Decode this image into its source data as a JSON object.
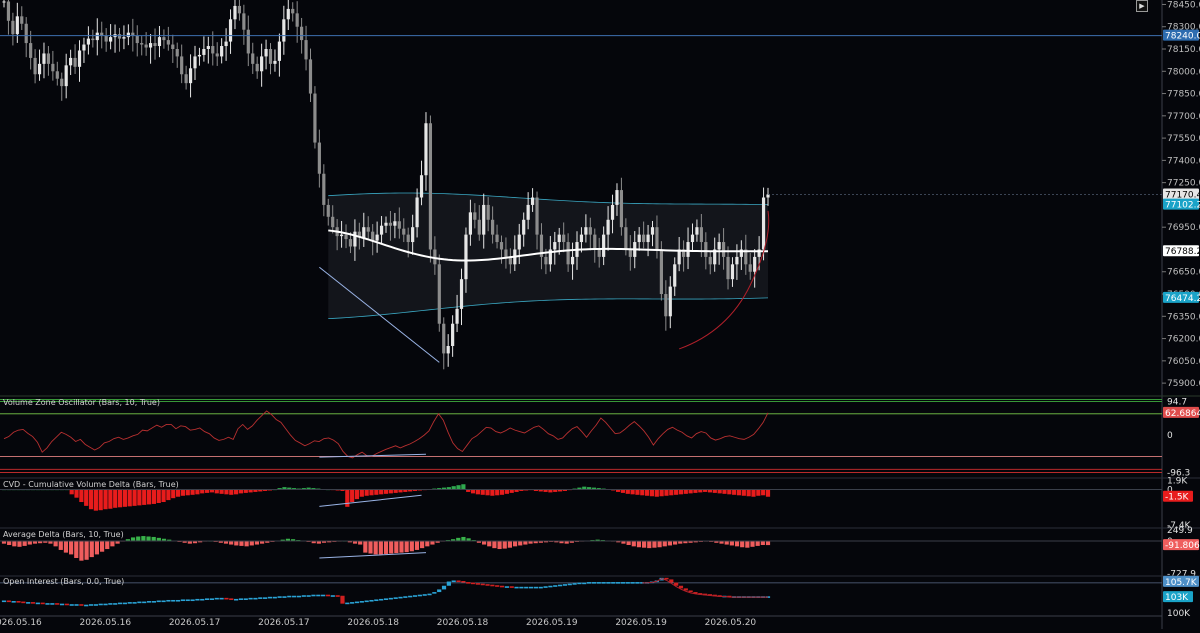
{
  "chart_data": [
    {
      "type": "candlestick",
      "title": "",
      "xlabel": "",
      "ylabel": "",
      "x_tick_labels": [
        "2026.05.16",
        "2026.05.16",
        "2026.05.17",
        "2026.05.17",
        "2026.05.18",
        "2026.05.18",
        "2026.05.19",
        "2026.05.19",
        "2026.05.20"
      ],
      "y_tick_labels": [
        "78450.0",
        "78300.0",
        "78150.0",
        "78000.0",
        "77850.0",
        "77700.0",
        "77550.0",
        "77400.0",
        "77250.0",
        "76950.0",
        "76650.0",
        "76500.0",
        "76350.0",
        "76200.0",
        "76050.0",
        "75900.0"
      ],
      "ylim": [
        75820,
        78480
      ],
      "horizontal_line": 78240.0,
      "last_price": 77170.4,
      "price_tags": [
        "78240.0",
        "77170.4",
        "77102.2",
        "76788.2",
        "76474.2"
      ],
      "vwap_band": {
        "upper": 77102.2,
        "mid": 76788.2,
        "lower": 76474.2
      },
      "closes": [
        78470,
        78340,
        78250,
        78370,
        78320,
        78190,
        78090,
        77980,
        78050,
        78120,
        78050,
        78000,
        77950,
        77900,
        78040,
        78090,
        78030,
        78140,
        78180,
        78220,
        78210,
        78260,
        78240,
        78200,
        78230,
        78250,
        78220,
        78230,
        78260,
        78240,
        78190,
        78180,
        78160,
        78190,
        78170,
        78230,
        78210,
        78180,
        78150,
        78100,
        77980,
        77920,
        78020,
        78100,
        78110,
        78150,
        78170,
        78120,
        78100,
        78170,
        78200,
        78350,
        78440,
        78390,
        78280,
        78120,
        78050,
        78000,
        78100,
        78150,
        78050,
        78070,
        78200,
        78350,
        78420,
        78390,
        78300,
        78210,
        78080,
        77850,
        77520,
        77310,
        77100,
        77020,
        76950,
        76890,
        76900,
        76870,
        76820,
        76920,
        76880,
        76950,
        76920,
        76860,
        76900,
        76960,
        76980,
        76960,
        76990,
        76940,
        76900,
        76850,
        76950,
        77150,
        77300,
        77650,
        76800,
        76700,
        76300,
        76100,
        76150,
        76300,
        76400,
        76600,
        76900,
        77050,
        77000,
        76900,
        77100,
        77000,
        76900,
        76850,
        76800,
        76750,
        76700,
        76800,
        76900,
        77000,
        77100,
        77150,
        76900,
        76750,
        76700,
        76800,
        76850,
        76900,
        76850,
        76700,
        76750,
        76850,
        76900,
        76950,
        76900,
        76800,
        76750,
        76900,
        77000,
        77100,
        77200,
        76950,
        76800,
        76750,
        76850,
        76900,
        76850,
        76900,
        76950,
        76800,
        76500,
        76350,
        76550,
        76700,
        76800,
        76750,
        76850,
        76900,
        76950,
        76850,
        76750,
        76700,
        76800,
        76850,
        76750,
        76600,
        76700,
        76750,
        76800,
        76700,
        76650,
        76750,
        76800,
        77150,
        77170.4
      ]
    },
    {
      "type": "line",
      "title": "Volume Zone Oscillator (Bars, 10, True)",
      "levels": [
        94.7,
        62.6864,
        0,
        -96.3
      ],
      "last_value": 62.6864,
      "series": [
        {
          "values": [
            -10,
            -4,
            8,
            14,
            16,
            5,
            -4,
            -20,
            -48,
            -36,
            -18,
            -5,
            8,
            2,
            -6,
            -18,
            -12,
            -26,
            -34,
            -42,
            -35,
            -22,
            -18,
            -10,
            -6,
            -12,
            -8,
            -2,
            2,
            14,
            12,
            20,
            28,
            22,
            30,
            30,
            18,
            26,
            24,
            14,
            16,
            20,
            10,
            4,
            -8,
            -15,
            -12,
            -6,
            -12,
            18,
            30,
            16,
            26,
            42,
            55,
            68,
            58,
            44,
            36,
            18,
            0,
            -15,
            -22,
            -30,
            -24,
            -16,
            -18,
            -10,
            -8,
            -14,
            -24,
            -46,
            -60,
            -64,
            -55,
            -48,
            -58,
            -60,
            -52,
            -46,
            -40,
            -35,
            -30,
            -36,
            -30,
            -25,
            -18,
            -10,
            0,
            12,
            38,
            60,
            42,
            8,
            -22,
            -38,
            -46,
            -28,
            -10,
            -2,
            10,
            22,
            20,
            10,
            6,
            12,
            20,
            14,
            10,
            6,
            14,
            22,
            26,
            16,
            4,
            -2,
            -12,
            -8,
            6,
            18,
            24,
            10,
            -6,
            12,
            28,
            48,
            36,
            20,
            4,
            6,
            16,
            28,
            38,
            26,
            12,
            -6,
            -28,
            -10,
            4,
            16,
            22,
            14,
            8,
            -2,
            -8,
            4,
            10,
            6,
            -8,
            -14,
            -10,
            -4,
            -2,
            -6,
            -10,
            -12,
            -6,
            2,
            18,
            36,
            62.6864
          ]
        }
      ]
    },
    {
      "type": "bar",
      "title": "CVD - Cumulative Volume Delta (Bars, True)",
      "levels": [
        1900,
        0,
        -7400
      ],
      "y_tick_labels": [
        "1.9K",
        "0",
        "-7.4K"
      ],
      "last_value_label": "-1.5K",
      "values": [
        0,
        0,
        0,
        0,
        0,
        0,
        0,
        0,
        0,
        0,
        0,
        0,
        0,
        0,
        -1000,
        -1700,
        -2600,
        -3400,
        -4100,
        -4400,
        -4300,
        -4100,
        -4000,
        -3800,
        -3700,
        -3600,
        -3500,
        -3400,
        -3300,
        -3200,
        -3100,
        -3000,
        -2800,
        -2600,
        -2200,
        -1800,
        -1500,
        -1300,
        -1200,
        -1100,
        -1000,
        -800,
        -700,
        -600,
        -800,
        -900,
        -1000,
        -1100,
        -1000,
        -800,
        -700,
        -600,
        -500,
        -400,
        -300,
        -200,
        0,
        300,
        500,
        400,
        300,
        200,
        300,
        400,
        300,
        200,
        100,
        0,
        -100,
        -200,
        -300,
        -3600,
        -2600,
        -2000,
        -1500,
        -1300,
        -1200,
        -1100,
        -1000,
        -900,
        -800,
        -700,
        -600,
        -500,
        -400,
        -300,
        -200,
        -100,
        100,
        200,
        300,
        400,
        500,
        700,
        900,
        1100,
        -500,
        -800,
        -1000,
        -1100,
        -1200,
        -1300,
        -1200,
        -1100,
        -900,
        -700,
        -500,
        -300,
        -200,
        -100,
        -300,
        -400,
        -500,
        -600,
        -500,
        -400,
        -300,
        -100,
        200,
        400,
        600,
        500,
        400,
        300,
        200,
        100,
        -200,
        -500,
        -700,
        -900,
        -1000,
        -1100,
        -1200,
        -1300,
        -1400,
        -1500,
        -1400,
        -1300,
        -1200,
        -1100,
        -1000,
        -900,
        -800,
        -700,
        -600,
        -500,
        -600,
        -700,
        -800,
        -900,
        -1000,
        -1100,
        -1200,
        -1300,
        -1400,
        -1500,
        -1300,
        -1200,
        -1500
      ]
    },
    {
      "type": "bar",
      "title": "Average Delta (Bars, 10, True)",
      "levels": [
        249.9,
        0,
        -727.9
      ],
      "y_tick_labels": [
        "249.9",
        "0",
        "-727.9"
      ],
      "last_value": -91.8065,
      "values": [
        -60,
        -90,
        -120,
        -130,
        -110,
        -80,
        -60,
        -50,
        -40,
        -60,
        -120,
        -200,
        -260,
        -300,
        -380,
        -440,
        -420,
        -360,
        -300,
        -240,
        -180,
        -120,
        -60,
        -10,
        40,
        80,
        100,
        110,
        100,
        90,
        70,
        50,
        30,
        10,
        -20,
        -40,
        -60,
        -50,
        -30,
        -10,
        0,
        -20,
        -40,
        -60,
        -80,
        -100,
        -110,
        -120,
        -100,
        -80,
        -60,
        -40,
        -20,
        10,
        30,
        50,
        40,
        20,
        10,
        -20,
        -50,
        -60,
        -40,
        -30,
        -20,
        -10,
        0,
        -30,
        -60,
        -80,
        -260,
        -280,
        -300,
        -300,
        -290,
        -280,
        -270,
        -260,
        -250,
        -230,
        -200,
        -160,
        -120,
        -80,
        -40,
        -10,
        20,
        40,
        70,
        90,
        60,
        20,
        -40,
        -80,
        -120,
        -160,
        -180,
        -170,
        -150,
        -120,
        -100,
        -80,
        -60,
        -50,
        -40,
        -30,
        -20,
        -30,
        -50,
        -60,
        -40,
        -20,
        -10,
        10,
        20,
        30,
        20,
        10,
        -10,
        -30,
        -60,
        -90,
        -120,
        -140,
        -150,
        -160,
        -150,
        -140,
        -120,
        -100,
        -80,
        -60,
        -50,
        -40,
        -30,
        -20,
        -10,
        -20,
        -40,
        -60,
        -80,
        -100,
        -120,
        -140,
        -150,
        -130,
        -110,
        -90,
        -91.8065
      ]
    },
    {
      "type": "bar",
      "title": "Open Interest (Bars, 0.0, True)",
      "y_tick_labels": [
        "105.7K",
        "103K",
        "100K"
      ],
      "last_value_label": "103K",
      "values": [
        102.2,
        102.1,
        102.1,
        102.0,
        101.9,
        101.9,
        101.8,
        101.8,
        101.7,
        101.7,
        101.7,
        101.6,
        101.6,
        101.5,
        101.5,
        101.5,
        101.4,
        101.4,
        101.5,
        101.5,
        101.6,
        101.6,
        101.7,
        101.7,
        101.8,
        101.8,
        101.9,
        101.9,
        102.0,
        102.0,
        102.1,
        102.1,
        102.2,
        102.2,
        102.3,
        102.3,
        102.3,
        102.4,
        102.4,
        102.4,
        102.5,
        102.5,
        102.6,
        102.6,
        102.7,
        102.7,
        102.6,
        102.5,
        102.5,
        102.6,
        102.6,
        102.7,
        102.7,
        102.8,
        102.8,
        102.9,
        102.9,
        103.0,
        103.0,
        103.1,
        103.1,
        103.1,
        103.2,
        103.2,
        103.3,
        103.3,
        103.3,
        103.2,
        103.2,
        103.1,
        101.6,
        101.8,
        101.9,
        102.0,
        102.1,
        102.2,
        102.3,
        102.4,
        102.5,
        102.6,
        102.7,
        102.8,
        102.9,
        103.0,
        103.1,
        103.2,
        103.3,
        103.4,
        103.5,
        103.8,
        104.3,
        105.0,
        105.8,
        106.0,
        105.9,
        105.7,
        105.6,
        105.5,
        105.4,
        105.3,
        105.2,
        105.1,
        105.0,
        104.9,
        104.9,
        104.8,
        104.8,
        104.8,
        104.8,
        104.8,
        104.8,
        104.8,
        104.9,
        105.0,
        105.1,
        105.2,
        105.3,
        105.4,
        105.5,
        105.6,
        105.6,
        105.7,
        105.7,
        105.7,
        105.7,
        105.7,
        105.7,
        105.7,
        105.7,
        105.7,
        105.7,
        105.7,
        105.7,
        105.7,
        105.8,
        106.0,
        106.5,
        106.2,
        105.6,
        105.0,
        104.5,
        104.1,
        103.8,
        103.6,
        103.5,
        103.4,
        103.3,
        103.2,
        103.1,
        103.1,
        103.0,
        103.0,
        103.0,
        103.0,
        103.0,
        103.0,
        103.0,
        103.0,
        103.0
      ]
    }
  ]
}
